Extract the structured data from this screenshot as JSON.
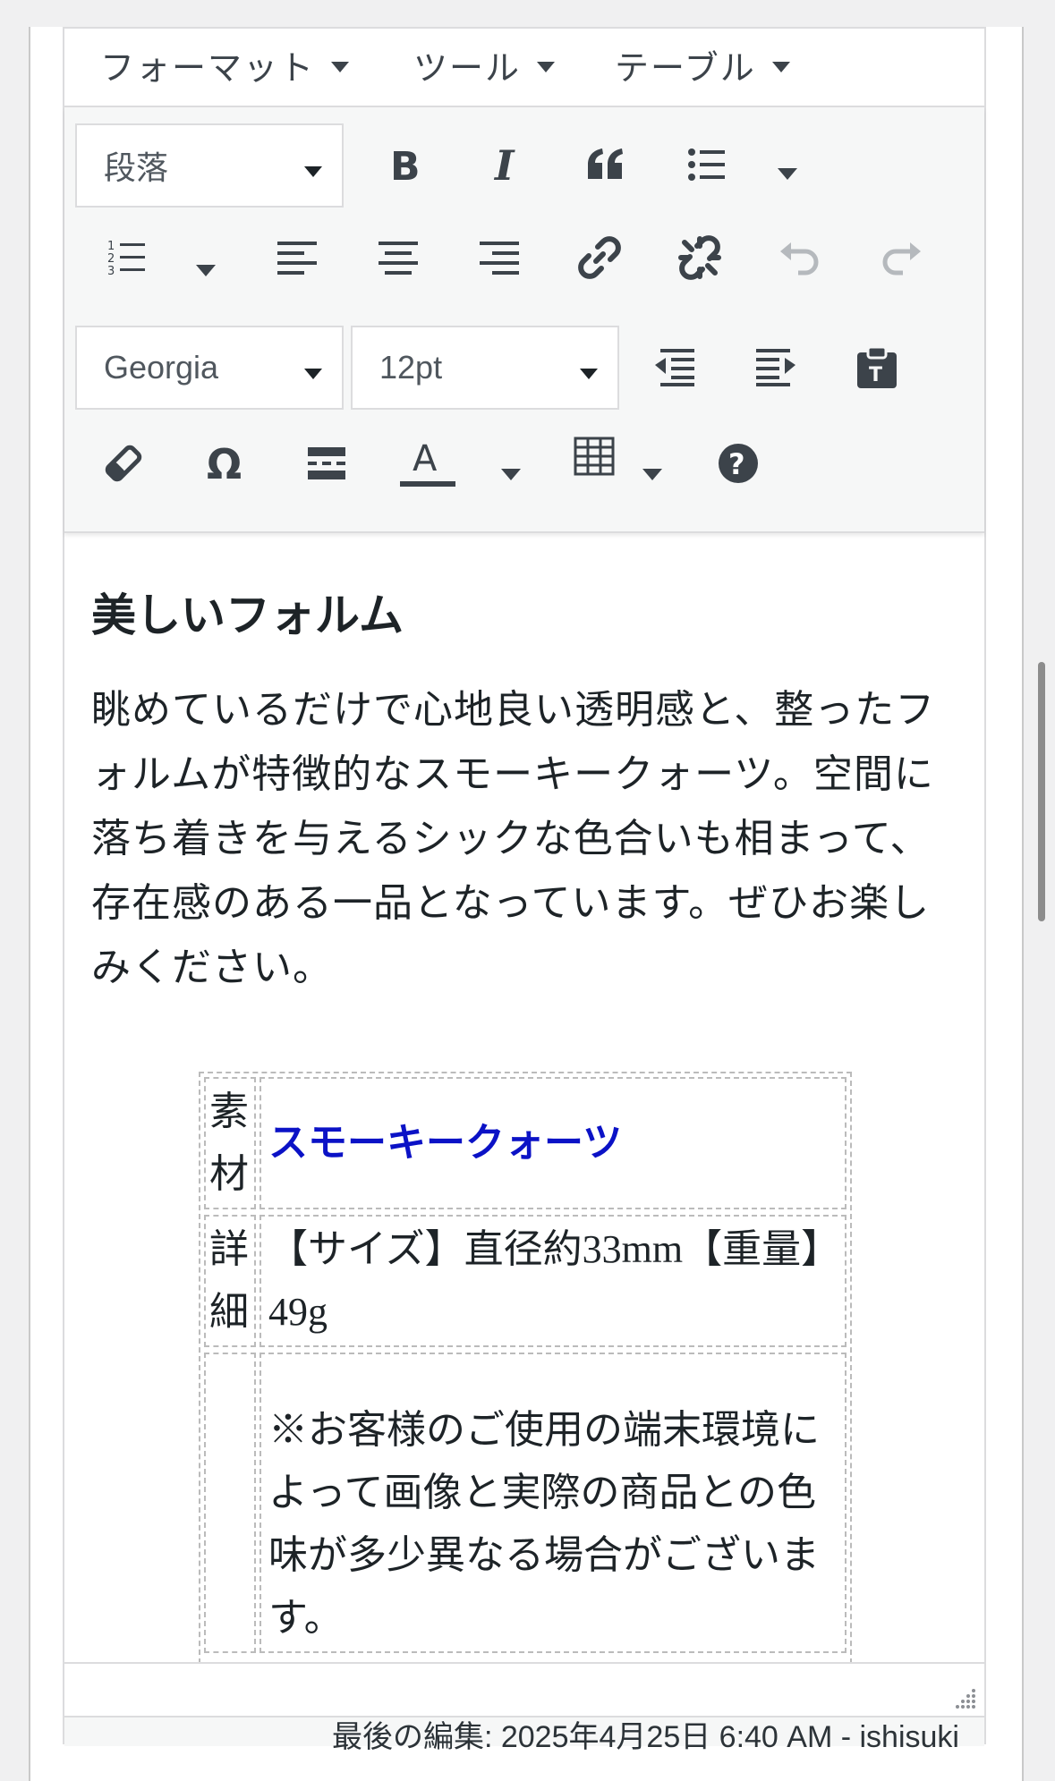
{
  "menubar": {
    "format": "フォーマット",
    "tools": "ツール",
    "table": "テーブル"
  },
  "toolbar": {
    "block_format": "段落",
    "font_family": "Georgia",
    "font_size": "12pt",
    "icons": [
      "bold-icon",
      "italic-icon",
      "blockquote-icon",
      "bullet-list-icon",
      "numbered-list-icon",
      "align-left-icon",
      "align-center-icon",
      "align-right-icon",
      "link-icon",
      "unlink-icon",
      "undo-icon",
      "redo-icon",
      "outdent-icon",
      "indent-icon",
      "paste-text-icon",
      "clear-formatting-icon",
      "special-character-icon",
      "read-more-icon",
      "text-color-icon",
      "table-icon",
      "help-icon"
    ]
  },
  "content": {
    "heading": "美しいフォルム",
    "paragraph": "眺めているだけで心地良い透明感と、整ったフォルムが特徴的なスモーキークォーツ。空間に落ち着きを与えるシックな色合いも相まって、存在感のある一品となっています。ぜひお楽しみください。",
    "table": [
      {
        "label": "素材",
        "value": "スモーキークォーツ"
      },
      {
        "label": "詳細",
        "value": "【サイズ】直径約33mm【重量】49g"
      },
      {
        "label": "",
        "value": "※お客様のご使用の端末環境によって画像と実際の商品との色味が多少異なる場合がございます。"
      }
    ]
  },
  "status": {
    "last_edited": "最後の編集: 2025年4月25日 6:40 AM - ishisuki"
  },
  "colors": {
    "link": "#0b12c6",
    "toolbar_bg": "#f6f7f7",
    "border": "#dcdcde"
  }
}
